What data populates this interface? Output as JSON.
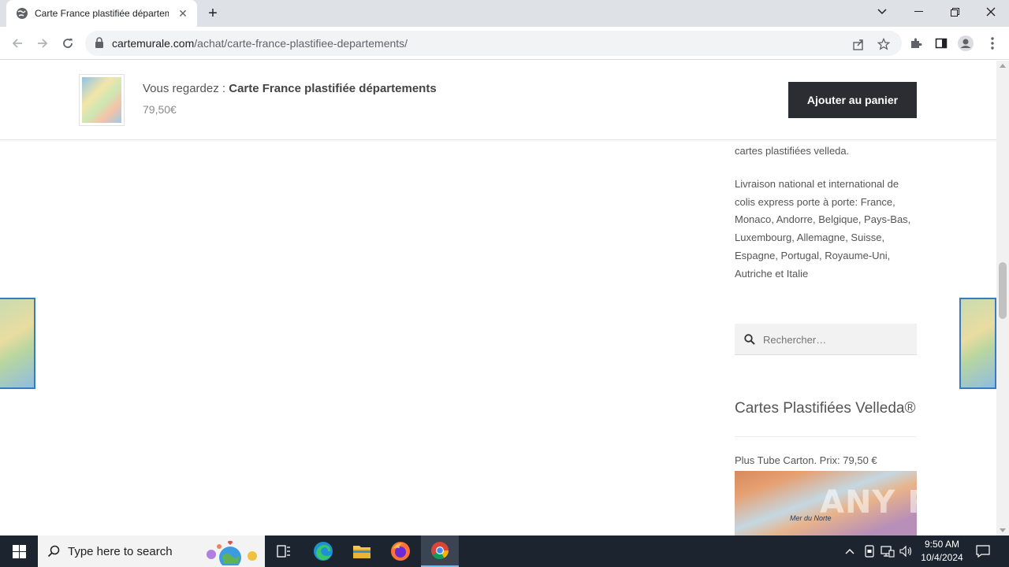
{
  "browser": {
    "tab_title": "Carte France plastifiée départem",
    "url_host": "cartemurale.com",
    "url_path": "/achat/carte-france-plastifiee-departements/"
  },
  "sticky_bar": {
    "viewing_label": "Vous regardez : ",
    "product_name": "Carte France plastifiée départements",
    "price": "79,50€",
    "add_to_cart": "Ajouter au panier"
  },
  "sidebar": {
    "intro_tail": "cartes plastifiées velleda.",
    "delivery_text": "Livraison national et international de colis express porte à porte: France, Monaco, Andorre, Belgique, Pays-Bas, Luxembourg, Allemagne, Suisse, Espagne, Portugal, Royaume-Uni, Autriche et Italie",
    "search_placeholder": "Rechercher…",
    "widget_title": "Cartes Plastifiées Velleda®",
    "product_caption": "Plus Tube Carton. Prix: 79,50 €",
    "map_label": "Mer du Norte"
  },
  "watermark": "ANY RUN",
  "taskbar": {
    "search_placeholder": "Type here to search",
    "time": "9:50 AM",
    "date": "10/4/2024"
  }
}
